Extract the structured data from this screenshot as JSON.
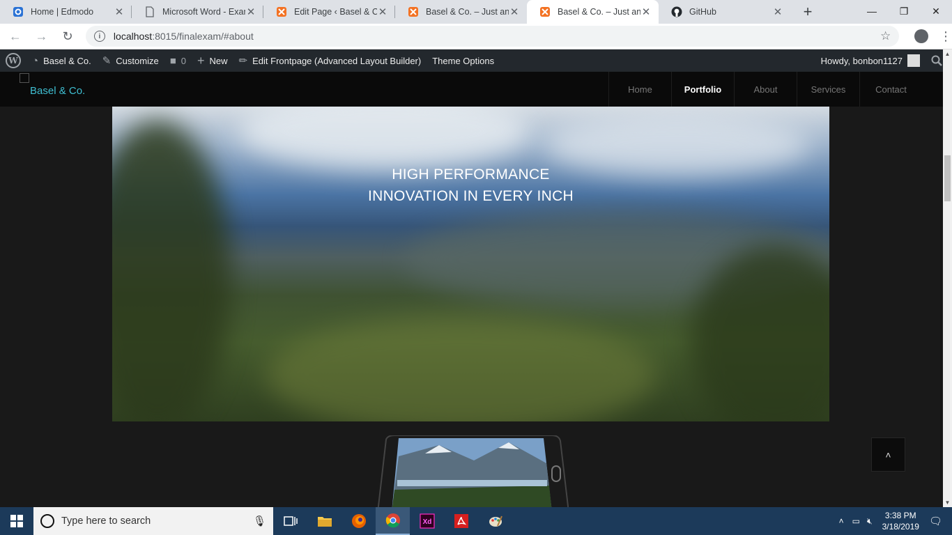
{
  "browser": {
    "tabs": [
      {
        "title": "Home | Edmodo",
        "icon": "edmodo-icon",
        "active": false
      },
      {
        "title": "Microsoft Word - Exam",
        "icon": "document-icon",
        "active": false
      },
      {
        "title": "Edit Page ‹ Basel & Co.",
        "icon": "xampp-icon",
        "active": false
      },
      {
        "title": "Basel & Co. – Just anoth",
        "icon": "xampp-icon",
        "active": false
      },
      {
        "title": "Basel & Co. – Just anoth",
        "icon": "xampp-icon",
        "active": true
      },
      {
        "title": "GitHub",
        "icon": "github-icon",
        "active": false
      }
    ],
    "url_host": "localhost",
    "url_path": ":8015/finalexam/#about"
  },
  "adminbar": {
    "site_name": "Basel & Co.",
    "customize": "Customize",
    "comments_count": "0",
    "new_label": "New",
    "edit_frontpage": "Edit Frontpage (Advanced Layout Builder)",
    "theme_options": "Theme Options",
    "howdy": "Howdy, bonbon1127"
  },
  "site": {
    "logo_alt": "Basel & Co.",
    "nav": [
      {
        "label": "Home",
        "current": false
      },
      {
        "label": "Portfolio",
        "current": true
      },
      {
        "label": "About",
        "current": false
      },
      {
        "label": "Services",
        "current": false
      },
      {
        "label": "Contact",
        "current": false
      }
    ],
    "hero_line1": "HIGH PERFORMANCE",
    "hero_line2": "INNOVATION IN EVERY INCH"
  },
  "taskbar": {
    "search_placeholder": "Type here to search",
    "time": "3:38 PM",
    "date": "3/18/2019"
  },
  "colors": {
    "admin_bar": "#23282d",
    "site_header": "#0a0a0a",
    "logo_link": "#3fbfd2",
    "taskbar": "#1c3a5a"
  }
}
